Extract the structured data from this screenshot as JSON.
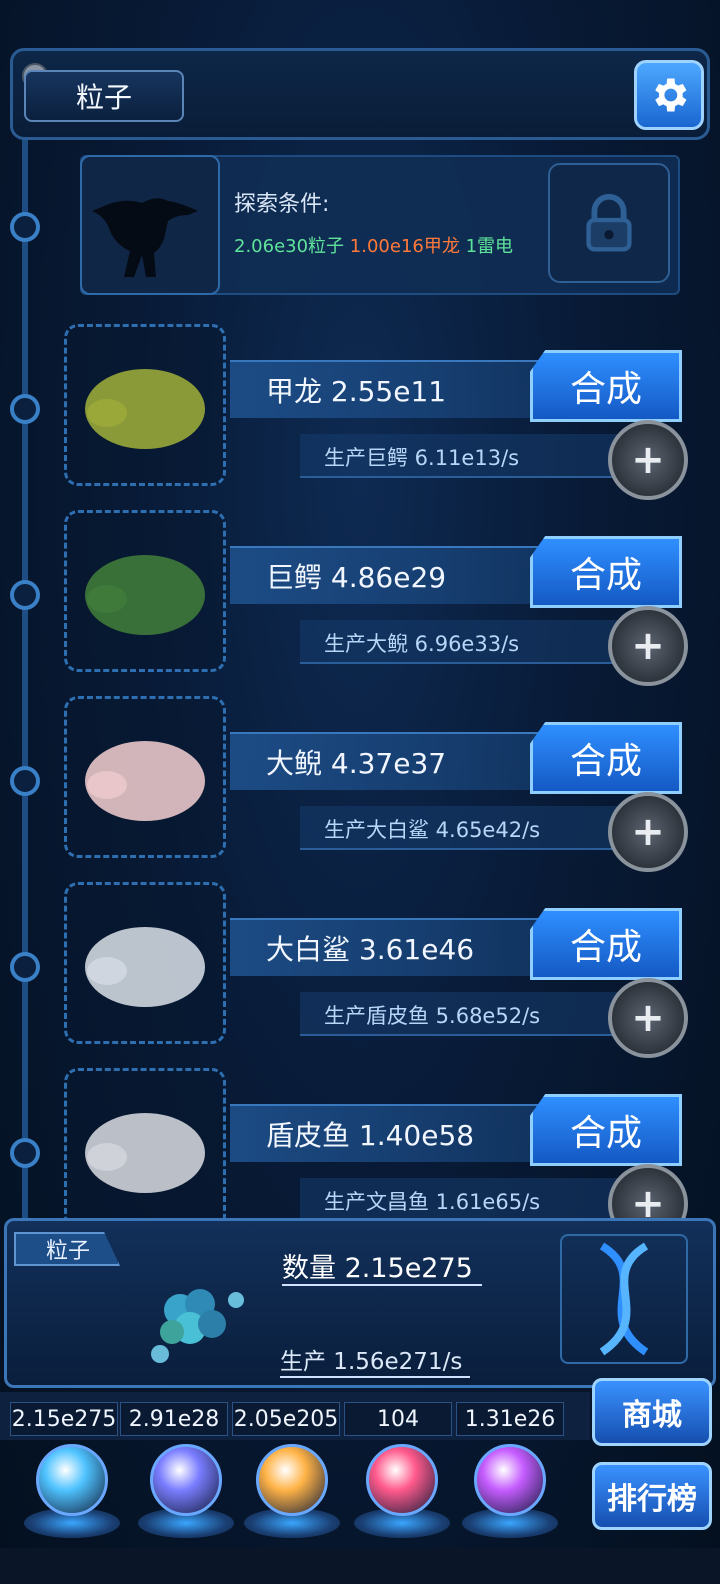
{
  "header": {
    "title": "粒子"
  },
  "explore": {
    "title": "探索条件:",
    "conditions": [
      {
        "text": "2.06e30粒子",
        "color": "#5fe39b"
      },
      {
        "text": "1.00e16甲龙",
        "color": "#ff7a3a"
      },
      {
        "text": "1雷电",
        "color": "#5fe39b"
      }
    ]
  },
  "creatures": [
    {
      "name": "甲龙 2.55e11",
      "production": "生产巨鳄 6.11e13/s",
      "action": "合成",
      "icon": "ankylosaurus-icon"
    },
    {
      "name": "巨鳄 4.86e29",
      "production": "生产大鲵 6.96e33/s",
      "action": "合成",
      "icon": "crocodile-icon"
    },
    {
      "name": "大鲵 4.37e37",
      "production": "生产大白鲨 4.65e42/s",
      "action": "合成",
      "icon": "salamander-icon"
    },
    {
      "name": "大白鲨 3.61e46",
      "production": "生产盾皮鱼 5.68e52/s",
      "action": "合成",
      "icon": "shark-icon"
    },
    {
      "name": "盾皮鱼 1.40e58",
      "production": "生产文昌鱼 1.61e65/s",
      "action": "合成",
      "icon": "dunkleosteus-icon"
    }
  ],
  "summary": {
    "tag": "粒子",
    "count": "数量 2.15e275",
    "production": "生产 1.56e271/s"
  },
  "resources": [
    {
      "value": "2.15e275",
      "orb_color": "#4fc3ff",
      "icon": "particle-orb-icon"
    },
    {
      "value": "2.91e28",
      "orb_color": "#7a7dff",
      "icon": "lightning-orb-icon"
    },
    {
      "value": "2.05e205",
      "orb_color": "#ffb347",
      "icon": "fire-orb-icon"
    },
    {
      "value": "104",
      "orb_color": "#ff5a8c",
      "icon": "brain-orb-icon"
    },
    {
      "value": "1.31e26",
      "orb_color": "#c55cff",
      "icon": "vortex-orb-icon"
    }
  ],
  "side_buttons": {
    "shop": "商城",
    "ranking": "排行榜"
  }
}
